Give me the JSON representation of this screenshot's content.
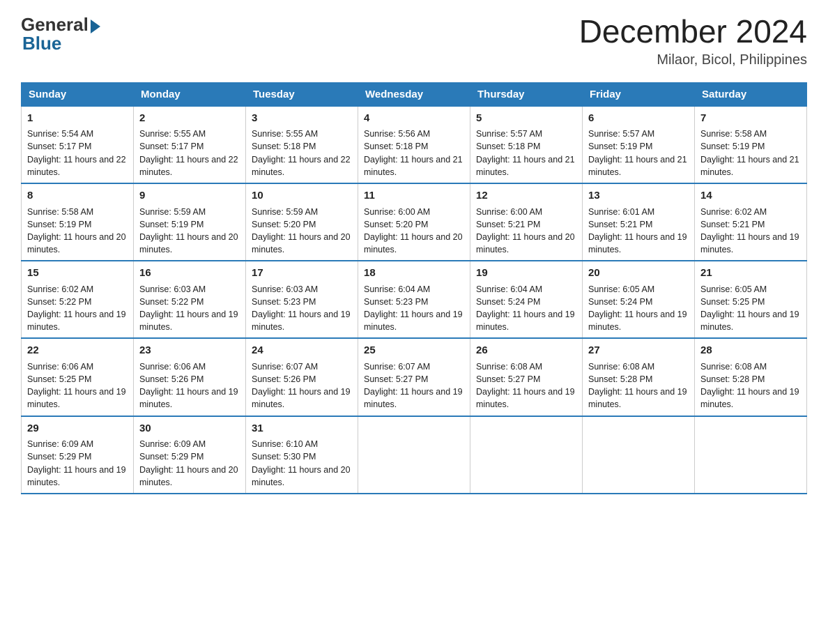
{
  "header": {
    "logo_general": "General",
    "logo_blue": "Blue",
    "month_year": "December 2024",
    "location": "Milaor, Bicol, Philippines"
  },
  "days_of_week": [
    "Sunday",
    "Monday",
    "Tuesday",
    "Wednesday",
    "Thursday",
    "Friday",
    "Saturday"
  ],
  "weeks": [
    [
      {
        "day": "1",
        "sunrise": "5:54 AM",
        "sunset": "5:17 PM",
        "daylight": "11 hours and 22 minutes."
      },
      {
        "day": "2",
        "sunrise": "5:55 AM",
        "sunset": "5:17 PM",
        "daylight": "11 hours and 22 minutes."
      },
      {
        "day": "3",
        "sunrise": "5:55 AM",
        "sunset": "5:18 PM",
        "daylight": "11 hours and 22 minutes."
      },
      {
        "day": "4",
        "sunrise": "5:56 AM",
        "sunset": "5:18 PM",
        "daylight": "11 hours and 21 minutes."
      },
      {
        "day": "5",
        "sunrise": "5:57 AM",
        "sunset": "5:18 PM",
        "daylight": "11 hours and 21 minutes."
      },
      {
        "day": "6",
        "sunrise": "5:57 AM",
        "sunset": "5:19 PM",
        "daylight": "11 hours and 21 minutes."
      },
      {
        "day": "7",
        "sunrise": "5:58 AM",
        "sunset": "5:19 PM",
        "daylight": "11 hours and 21 minutes."
      }
    ],
    [
      {
        "day": "8",
        "sunrise": "5:58 AM",
        "sunset": "5:19 PM",
        "daylight": "11 hours and 20 minutes."
      },
      {
        "day": "9",
        "sunrise": "5:59 AM",
        "sunset": "5:19 PM",
        "daylight": "11 hours and 20 minutes."
      },
      {
        "day": "10",
        "sunrise": "5:59 AM",
        "sunset": "5:20 PM",
        "daylight": "11 hours and 20 minutes."
      },
      {
        "day": "11",
        "sunrise": "6:00 AM",
        "sunset": "5:20 PM",
        "daylight": "11 hours and 20 minutes."
      },
      {
        "day": "12",
        "sunrise": "6:00 AM",
        "sunset": "5:21 PM",
        "daylight": "11 hours and 20 minutes."
      },
      {
        "day": "13",
        "sunrise": "6:01 AM",
        "sunset": "5:21 PM",
        "daylight": "11 hours and 19 minutes."
      },
      {
        "day": "14",
        "sunrise": "6:02 AM",
        "sunset": "5:21 PM",
        "daylight": "11 hours and 19 minutes."
      }
    ],
    [
      {
        "day": "15",
        "sunrise": "6:02 AM",
        "sunset": "5:22 PM",
        "daylight": "11 hours and 19 minutes."
      },
      {
        "day": "16",
        "sunrise": "6:03 AM",
        "sunset": "5:22 PM",
        "daylight": "11 hours and 19 minutes."
      },
      {
        "day": "17",
        "sunrise": "6:03 AM",
        "sunset": "5:23 PM",
        "daylight": "11 hours and 19 minutes."
      },
      {
        "day": "18",
        "sunrise": "6:04 AM",
        "sunset": "5:23 PM",
        "daylight": "11 hours and 19 minutes."
      },
      {
        "day": "19",
        "sunrise": "6:04 AM",
        "sunset": "5:24 PM",
        "daylight": "11 hours and 19 minutes."
      },
      {
        "day": "20",
        "sunrise": "6:05 AM",
        "sunset": "5:24 PM",
        "daylight": "11 hours and 19 minutes."
      },
      {
        "day": "21",
        "sunrise": "6:05 AM",
        "sunset": "5:25 PM",
        "daylight": "11 hours and 19 minutes."
      }
    ],
    [
      {
        "day": "22",
        "sunrise": "6:06 AM",
        "sunset": "5:25 PM",
        "daylight": "11 hours and 19 minutes."
      },
      {
        "day": "23",
        "sunrise": "6:06 AM",
        "sunset": "5:26 PM",
        "daylight": "11 hours and 19 minutes."
      },
      {
        "day": "24",
        "sunrise": "6:07 AM",
        "sunset": "5:26 PM",
        "daylight": "11 hours and 19 minutes."
      },
      {
        "day": "25",
        "sunrise": "6:07 AM",
        "sunset": "5:27 PM",
        "daylight": "11 hours and 19 minutes."
      },
      {
        "day": "26",
        "sunrise": "6:08 AM",
        "sunset": "5:27 PM",
        "daylight": "11 hours and 19 minutes."
      },
      {
        "day": "27",
        "sunrise": "6:08 AM",
        "sunset": "5:28 PM",
        "daylight": "11 hours and 19 minutes."
      },
      {
        "day": "28",
        "sunrise": "6:08 AM",
        "sunset": "5:28 PM",
        "daylight": "11 hours and 19 minutes."
      }
    ],
    [
      {
        "day": "29",
        "sunrise": "6:09 AM",
        "sunset": "5:29 PM",
        "daylight": "11 hours and 19 minutes."
      },
      {
        "day": "30",
        "sunrise": "6:09 AM",
        "sunset": "5:29 PM",
        "daylight": "11 hours and 20 minutes."
      },
      {
        "day": "31",
        "sunrise": "6:10 AM",
        "sunset": "5:30 PM",
        "daylight": "11 hours and 20 minutes."
      },
      null,
      null,
      null,
      null
    ]
  ]
}
